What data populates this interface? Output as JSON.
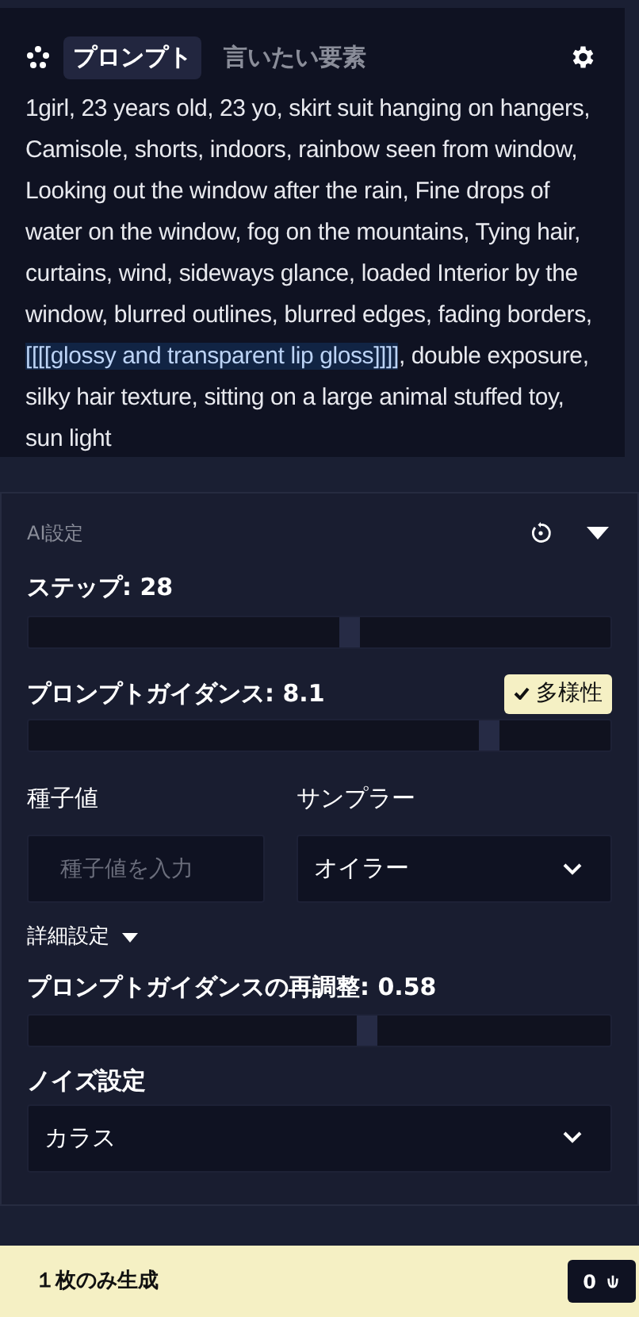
{
  "prompt_panel": {
    "tabs": [
      {
        "label": "プロンプト",
        "selected": true
      },
      {
        "label": "言いたい要素",
        "selected": false
      }
    ],
    "segments": [
      {
        "text": "1girl, 23 years old, 23 yo, skirt suit hanging on hangers, Camisole, shorts, indoors, rainbow seen from window, Looking out the window after the rain, Fine drops of water on the window, fog on the mountains, Tying hair, curtains, wind, sideways glance, loaded Interior by the window, blurred outlines, blurred edges, fading borders, ",
        "highlighted": false
      },
      {
        "text": "[[[[glossy and transparent lip gloss]]]]",
        "highlighted": true
      },
      {
        "text": ", double exposure, silky hair texture, sitting on a large animal stuffed toy, sun light",
        "highlighted": false
      }
    ]
  },
  "ai_settings": {
    "title": "AI設定",
    "expanded": true,
    "steps": {
      "label": "ステップ: 28",
      "level": 0.55
    },
    "guidance": {
      "label": "プロンプトガイダンス: 8.1",
      "level": 0.79,
      "variety": {
        "label": "多様性",
        "checked": true
      }
    },
    "seed": {
      "label": "種子値",
      "placeholder": "種子値を入力"
    },
    "sampler": {
      "label": "サンプラー",
      "value": "オイラー"
    },
    "advanced": {
      "label": "詳細設定",
      "expanded": true
    },
    "rescale": {
      "label": "プロンプトガイダンスの再調整: 0.58",
      "level": 0.58
    },
    "noise": {
      "label": "ノイズ設定",
      "value": "カラス"
    }
  },
  "generate_bar": {
    "label": "１枚のみ生成",
    "cost": "0"
  }
}
